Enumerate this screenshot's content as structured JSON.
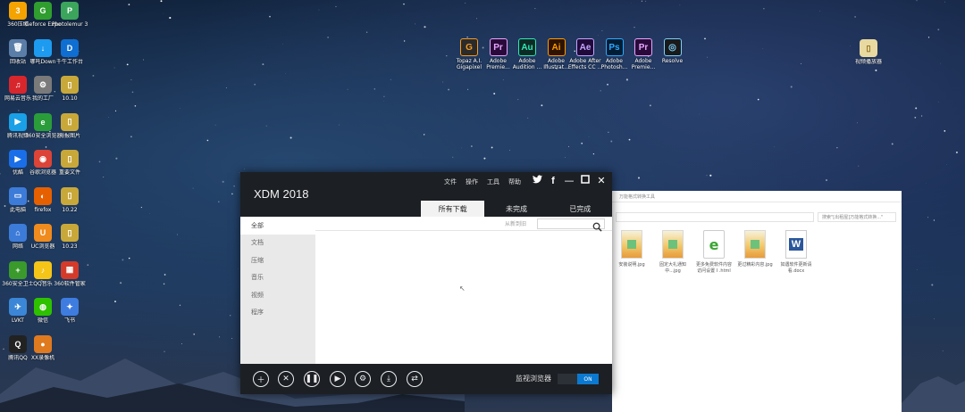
{
  "desktop": {
    "icons_left": [
      {
        "label": "360压缩",
        "glyph": "3",
        "color": "#f4a300",
        "icon": "archive-icon"
      },
      {
        "label": "Geforce Experience",
        "glyph": "G",
        "color": "#2f9e2f",
        "icon": "nvidia-icon"
      },
      {
        "label": "Photolemur 3",
        "glyph": "P",
        "color": "#3ba55c",
        "icon": "photolemur-icon"
      },
      {
        "label": "回收站",
        "glyph": "🗑",
        "color": "#5a7ea8",
        "icon": "recycle-bin-icon"
      },
      {
        "label": "哪吒Down",
        "glyph": "↓",
        "color": "#1d9bf0",
        "icon": "download-icon"
      },
      {
        "label": "千牛工作台",
        "glyph": "D",
        "color": "#0f6ed1",
        "icon": "qianniu-icon"
      },
      {
        "label": "网易云音乐",
        "glyph": "♫",
        "color": "#d8262d",
        "icon": "netease-music-icon"
      },
      {
        "label": "我的工厂",
        "glyph": "⚙",
        "color": "#7a7a7a",
        "icon": "factory-icon"
      },
      {
        "label": "10.10",
        "glyph": "▯",
        "color": "#c9a83a",
        "icon": "file-icon"
      },
      {
        "label": "腾讯视频",
        "glyph": "▶",
        "color": "#19a0e6",
        "icon": "tencent-video-icon"
      },
      {
        "label": "360安全浏览器",
        "glyph": "e",
        "color": "#2a9d3a",
        "icon": "360-browser-icon"
      },
      {
        "label": "海报图片",
        "glyph": "▯",
        "color": "#c9a83a",
        "icon": "file-icon"
      },
      {
        "label": "优酷",
        "glyph": "▶",
        "color": "#1a6ee8",
        "icon": "youku-icon"
      },
      {
        "label": "谷歌浏览器",
        "glyph": "◉",
        "color": "#db4437",
        "icon": "chrome-icon"
      },
      {
        "label": "重要文件",
        "glyph": "▯",
        "color": "#c9a83a",
        "icon": "file-icon"
      },
      {
        "label": "此电脑",
        "glyph": "▭",
        "color": "#3d7bd8",
        "icon": "this-pc-icon"
      },
      {
        "label": "firefox",
        "glyph": "◐",
        "color": "#e66000",
        "icon": "firefox-icon"
      },
      {
        "label": "10.22",
        "glyph": "▯",
        "color": "#c9a83a",
        "icon": "file-icon"
      },
      {
        "label": "网络",
        "glyph": "⌂",
        "color": "#3d7bd8",
        "icon": "network-icon"
      },
      {
        "label": "UC浏览器",
        "glyph": "U",
        "color": "#f08b1d",
        "icon": "uc-browser-icon"
      },
      {
        "label": "10.23",
        "glyph": "▯",
        "color": "#c9a83a",
        "icon": "file-icon"
      },
      {
        "label": "360安全卫士",
        "glyph": "+",
        "color": "#3a9a2b",
        "icon": "360-security-icon"
      },
      {
        "label": "QQ音乐",
        "glyph": "♪",
        "color": "#f5c518",
        "icon": "qq-music-icon"
      },
      {
        "label": "360软件管家",
        "glyph": "▦",
        "color": "#d43a2a",
        "icon": "360-software-icon"
      },
      {
        "label": "LVKT",
        "glyph": "✈",
        "color": "#3b86d6",
        "icon": "lvkt-icon"
      },
      {
        "label": "微信",
        "glyph": "◍",
        "color": "#2dc100",
        "icon": "wechat-icon"
      },
      {
        "label": "飞书",
        "glyph": "✦",
        "color": "#3e7ce0",
        "icon": "feishu-icon"
      },
      {
        "label": "腾讯QQ",
        "glyph": "Q",
        "color": "#222222",
        "icon": "qq-icon"
      },
      {
        "label": "XX录像机",
        "glyph": "●",
        "color": "#e07a1f",
        "icon": "recorder-icon"
      }
    ],
    "adobe_icons": [
      {
        "label": "Topaz A.I. Gigapixel",
        "glyph": "G",
        "color": "#2b2b2b",
        "fg": "#f39c28",
        "icon": "topaz-icon"
      },
      {
        "label": "Adobe Premie...",
        "glyph": "Pr",
        "color": "#2a0a3a",
        "fg": "#e9a6ff",
        "icon": "premiere-icon"
      },
      {
        "label": "Adobe Audition ...",
        "glyph": "Au",
        "color": "#0d2b24",
        "fg": "#2ee8b8",
        "icon": "audition-icon"
      },
      {
        "label": "Adobe Illustrat...",
        "glyph": "Ai",
        "color": "#2e1400",
        "fg": "#ff9a00",
        "icon": "illustrator-icon"
      },
      {
        "label": "Adobe After Effects CC ...",
        "glyph": "Ae",
        "color": "#1f0a3a",
        "fg": "#c5a5ff",
        "icon": "after-effects-icon"
      },
      {
        "label": "Adobe Photosh...",
        "glyph": "Ps",
        "color": "#001d34",
        "fg": "#31a8ff",
        "icon": "photoshop-icon"
      },
      {
        "label": "Adobe Premie...",
        "glyph": "Pr",
        "color": "#2a0a3a",
        "fg": "#e9a6ff",
        "icon": "premiere-icon"
      },
      {
        "label": "Resolve",
        "glyph": "◎",
        "color": "#1a1a1a",
        "fg": "#7ad0ff",
        "icon": "resolve-icon"
      }
    ],
    "right_icon": {
      "label": "视频播放器",
      "glyph": "▯",
      "color": "#e8d9a0",
      "icon": "file-icon"
    }
  },
  "xdm": {
    "title": "XDM 2018",
    "menu": [
      "文件",
      "操作",
      "工具",
      "帮助"
    ],
    "tabs": [
      {
        "label": "所有下载",
        "active": true
      },
      {
        "label": "未完成",
        "active": false
      },
      {
        "label": "已完成",
        "active": false
      }
    ],
    "categories": [
      {
        "label": "全部",
        "active": true
      },
      {
        "label": "文档",
        "active": false
      },
      {
        "label": "压缩",
        "active": false
      },
      {
        "label": "音乐",
        "active": false
      },
      {
        "label": "视频",
        "active": false
      },
      {
        "label": "程序",
        "active": false
      }
    ],
    "sort_label": "从新到旧",
    "search_value": "",
    "monitor_label": "监视浏览器",
    "toggle_label": "ON"
  },
  "explorer": {
    "path_text": "万能格式转换工具",
    "search_placeholder": "搜索\"[出租屋]万能格式转换...\"",
    "files": [
      {
        "name": "安装说明.jpg",
        "type": "jpg"
      },
      {
        "name": "固定大礼通知中...jpg",
        "type": "jpg"
      },
      {
        "name": "更多免费软件内容访问设置 I .html",
        "type": "html"
      },
      {
        "name": "更过精彩内容.jpg",
        "type": "jpg"
      },
      {
        "name": "如遇软件更新请看.docx",
        "type": "docx"
      }
    ]
  }
}
